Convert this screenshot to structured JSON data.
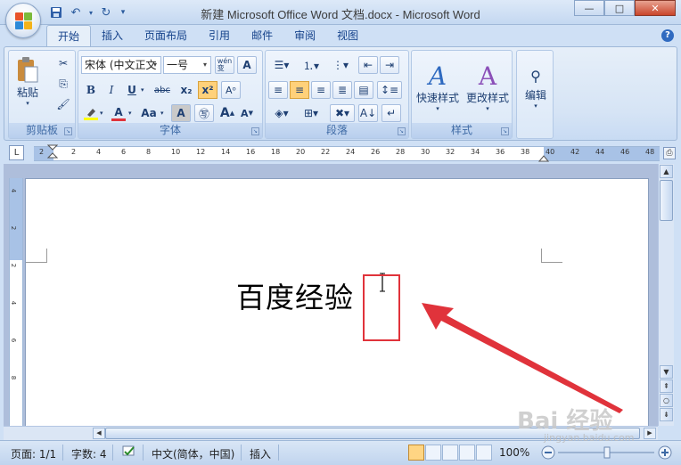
{
  "window": {
    "title": "新建 Microsoft Office Word 文档.docx - Microsoft Word",
    "controls": {
      "minimize": "—",
      "maximize": "□",
      "close": "✕"
    }
  },
  "qat": {
    "icons": [
      "save-icon",
      "undo-icon",
      "redo-icon",
      "customize-icon"
    ]
  },
  "tabs": [
    "开始",
    "插入",
    "页面布局",
    "引用",
    "邮件",
    "审阅",
    "视图"
  ],
  "active_tab": "开始",
  "ribbon": {
    "clipboard": {
      "label": "剪贴板",
      "paste": "粘贴"
    },
    "font": {
      "label": "字体",
      "font_name": "宋体 (中文正文",
      "font_size": "一号",
      "wen": "wén\n变",
      "bold": "B",
      "italic": "I",
      "underline": "U",
      "strike": "abc",
      "sub": "x₂",
      "sup": "x²",
      "font_color": "A",
      "change_case": "Aa",
      "shade": "A",
      "grow": "A",
      "shrink": "A"
    },
    "paragraph": {
      "label": "段落"
    },
    "styles": {
      "label": "样式",
      "quick": "快速样式",
      "change": "更改样式"
    },
    "editing": {
      "label": "编辑"
    }
  },
  "ruler": {
    "tab_selector": "L",
    "ticks": [
      "2",
      "2",
      "4",
      "6",
      "8",
      "10",
      "12",
      "14",
      "16",
      "18",
      "20",
      "22",
      "24",
      "26",
      "28",
      "30",
      "32",
      "34",
      "36",
      "38",
      "40",
      "42",
      "44",
      "46",
      "48"
    ],
    "vticks": [
      "4",
      "2",
      "2",
      "4",
      "6",
      "8"
    ]
  },
  "document": {
    "text": "百度经验"
  },
  "annotation": {
    "highlight_color": "#e0333b"
  },
  "status": {
    "page": "页面: 1/1",
    "words": "字数: 4",
    "language": "中文(简体，中国)",
    "mode": "插入",
    "zoom": "100%"
  },
  "watermark": {
    "brand": "Bai 经验",
    "url": "jingyan.baidu.com"
  }
}
